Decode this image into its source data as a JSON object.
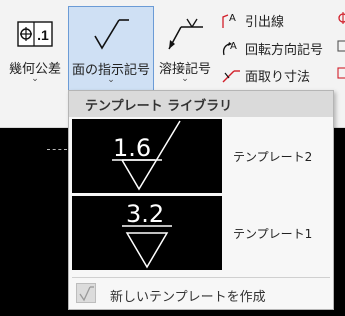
{
  "ribbon": {
    "geo_tolerance": {
      "label": "幾何公差",
      "icon": "geometric-tolerance-icon",
      "icon_text": "⊕.1"
    },
    "surface_symbol": {
      "label": "面の指示記号",
      "icon": "surface-texture-icon"
    },
    "weld_symbol": {
      "label": "溶接記号",
      "icon": "weld-symbol-icon"
    },
    "small_items": [
      {
        "label": "引出線",
        "icon": "leader-line-icon"
      },
      {
        "label": "回転方向記号",
        "icon": "rotation-direction-icon"
      },
      {
        "label": "面取り寸法",
        "icon": "chamfer-dimension-icon"
      }
    ],
    "chevron": "⌄"
  },
  "popup": {
    "title": "テンプレート ライブラリ",
    "templates": [
      {
        "label": "テンプレート2",
        "value": "1.6"
      },
      {
        "label": "テンプレート1",
        "value": "3.2"
      }
    ],
    "new_template": "新しいテンプレートを作成"
  },
  "colors": {
    "selected_bg": "#cfe0f4",
    "selected_border": "#6b9bd6",
    "canvas": "#000000",
    "accent_red": "#d21f2a"
  }
}
